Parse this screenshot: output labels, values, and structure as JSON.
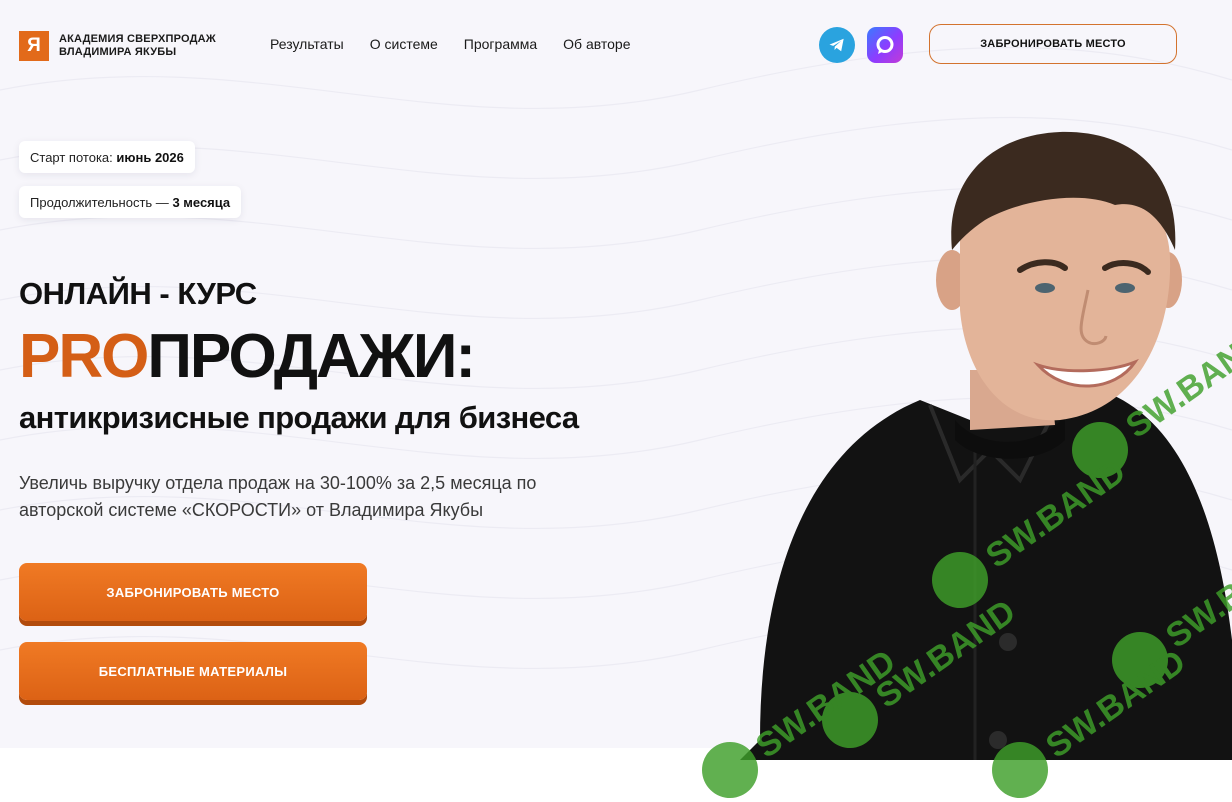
{
  "brand": {
    "logo_letter": "Я",
    "line1": "АКАДЕМИЯ СВЕРХПРОДАЖ",
    "line2": "ВЛАДИМИРА ЯКУБЫ",
    "accent_color": "#e26a1a"
  },
  "nav": {
    "items": [
      {
        "label": "Результаты"
      },
      {
        "label": "О системе"
      },
      {
        "label": "Программа"
      },
      {
        "label": "Об авторе"
      }
    ]
  },
  "social": {
    "telegram_icon": "telegram-icon",
    "max_icon": "max-messenger-icon"
  },
  "header": {
    "cta_label": "ЗАБРОНИРОВАТЬ МЕСТО"
  },
  "badges": {
    "start_label": "Старт потока: ",
    "start_value": "июнь 2026",
    "duration_label": "Продолжительность — ",
    "duration_value": "3 месяца"
  },
  "hero": {
    "kicker": "ОНЛАЙН - КУРС",
    "title_accent": "PRO",
    "title_main": "ПРОДАЖИ:",
    "subtitle": "антикризисные продажи для бизнеса",
    "description": "Увеличь выручку отдела продаж на 30-100% за 2,5 месяца по авторской системе «СКОРОСТИ» от Владимира Якубы",
    "primary_button": "ЗАБРОНИРОВАТЬ МЕСТО",
    "secondary_button": "БЕСПЛАТНЫЕ МАТЕРИАЛЫ",
    "button_color": "#e86e1c"
  },
  "watermark": {
    "text": "SW.BAND"
  }
}
